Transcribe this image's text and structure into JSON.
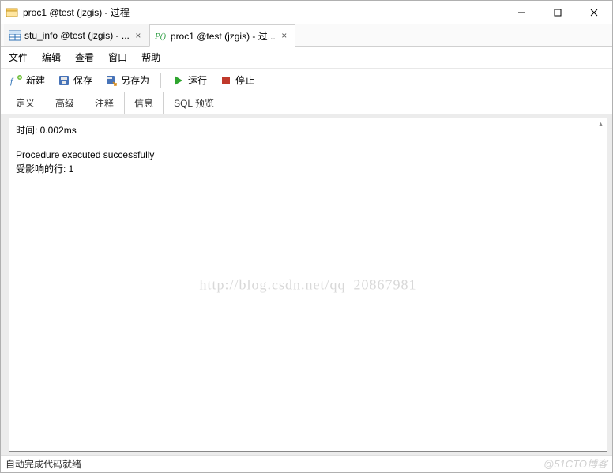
{
  "window": {
    "title": "proc1 @test (jzgis) - 过程"
  },
  "doc_tabs": [
    {
      "label": "stu_info @test (jzgis) - ...",
      "active": false
    },
    {
      "label": "proc1 @test (jzgis) - 过...",
      "active": true
    }
  ],
  "menubar": [
    "文件",
    "编辑",
    "查看",
    "窗口",
    "帮助"
  ],
  "toolbar": {
    "new_label": "新建",
    "save_label": "保存",
    "saveas_label": "另存为",
    "run_label": "运行",
    "stop_label": "停止"
  },
  "inner_tabs": [
    {
      "label": "定义",
      "active": false
    },
    {
      "label": "高级",
      "active": false
    },
    {
      "label": "注释",
      "active": false
    },
    {
      "label": "信息",
      "active": true
    },
    {
      "label": "SQL 预览",
      "active": false
    }
  ],
  "content": {
    "line1": "时间: 0.002ms",
    "line2": "Procedure executed successfully",
    "line3": "受影响的行: 1"
  },
  "watermark_center": "http://blog.csdn.net/qq_20867981",
  "watermark_bottom": "@51CTO博客",
  "statusbar": {
    "text": "自动完成代码就绪"
  }
}
